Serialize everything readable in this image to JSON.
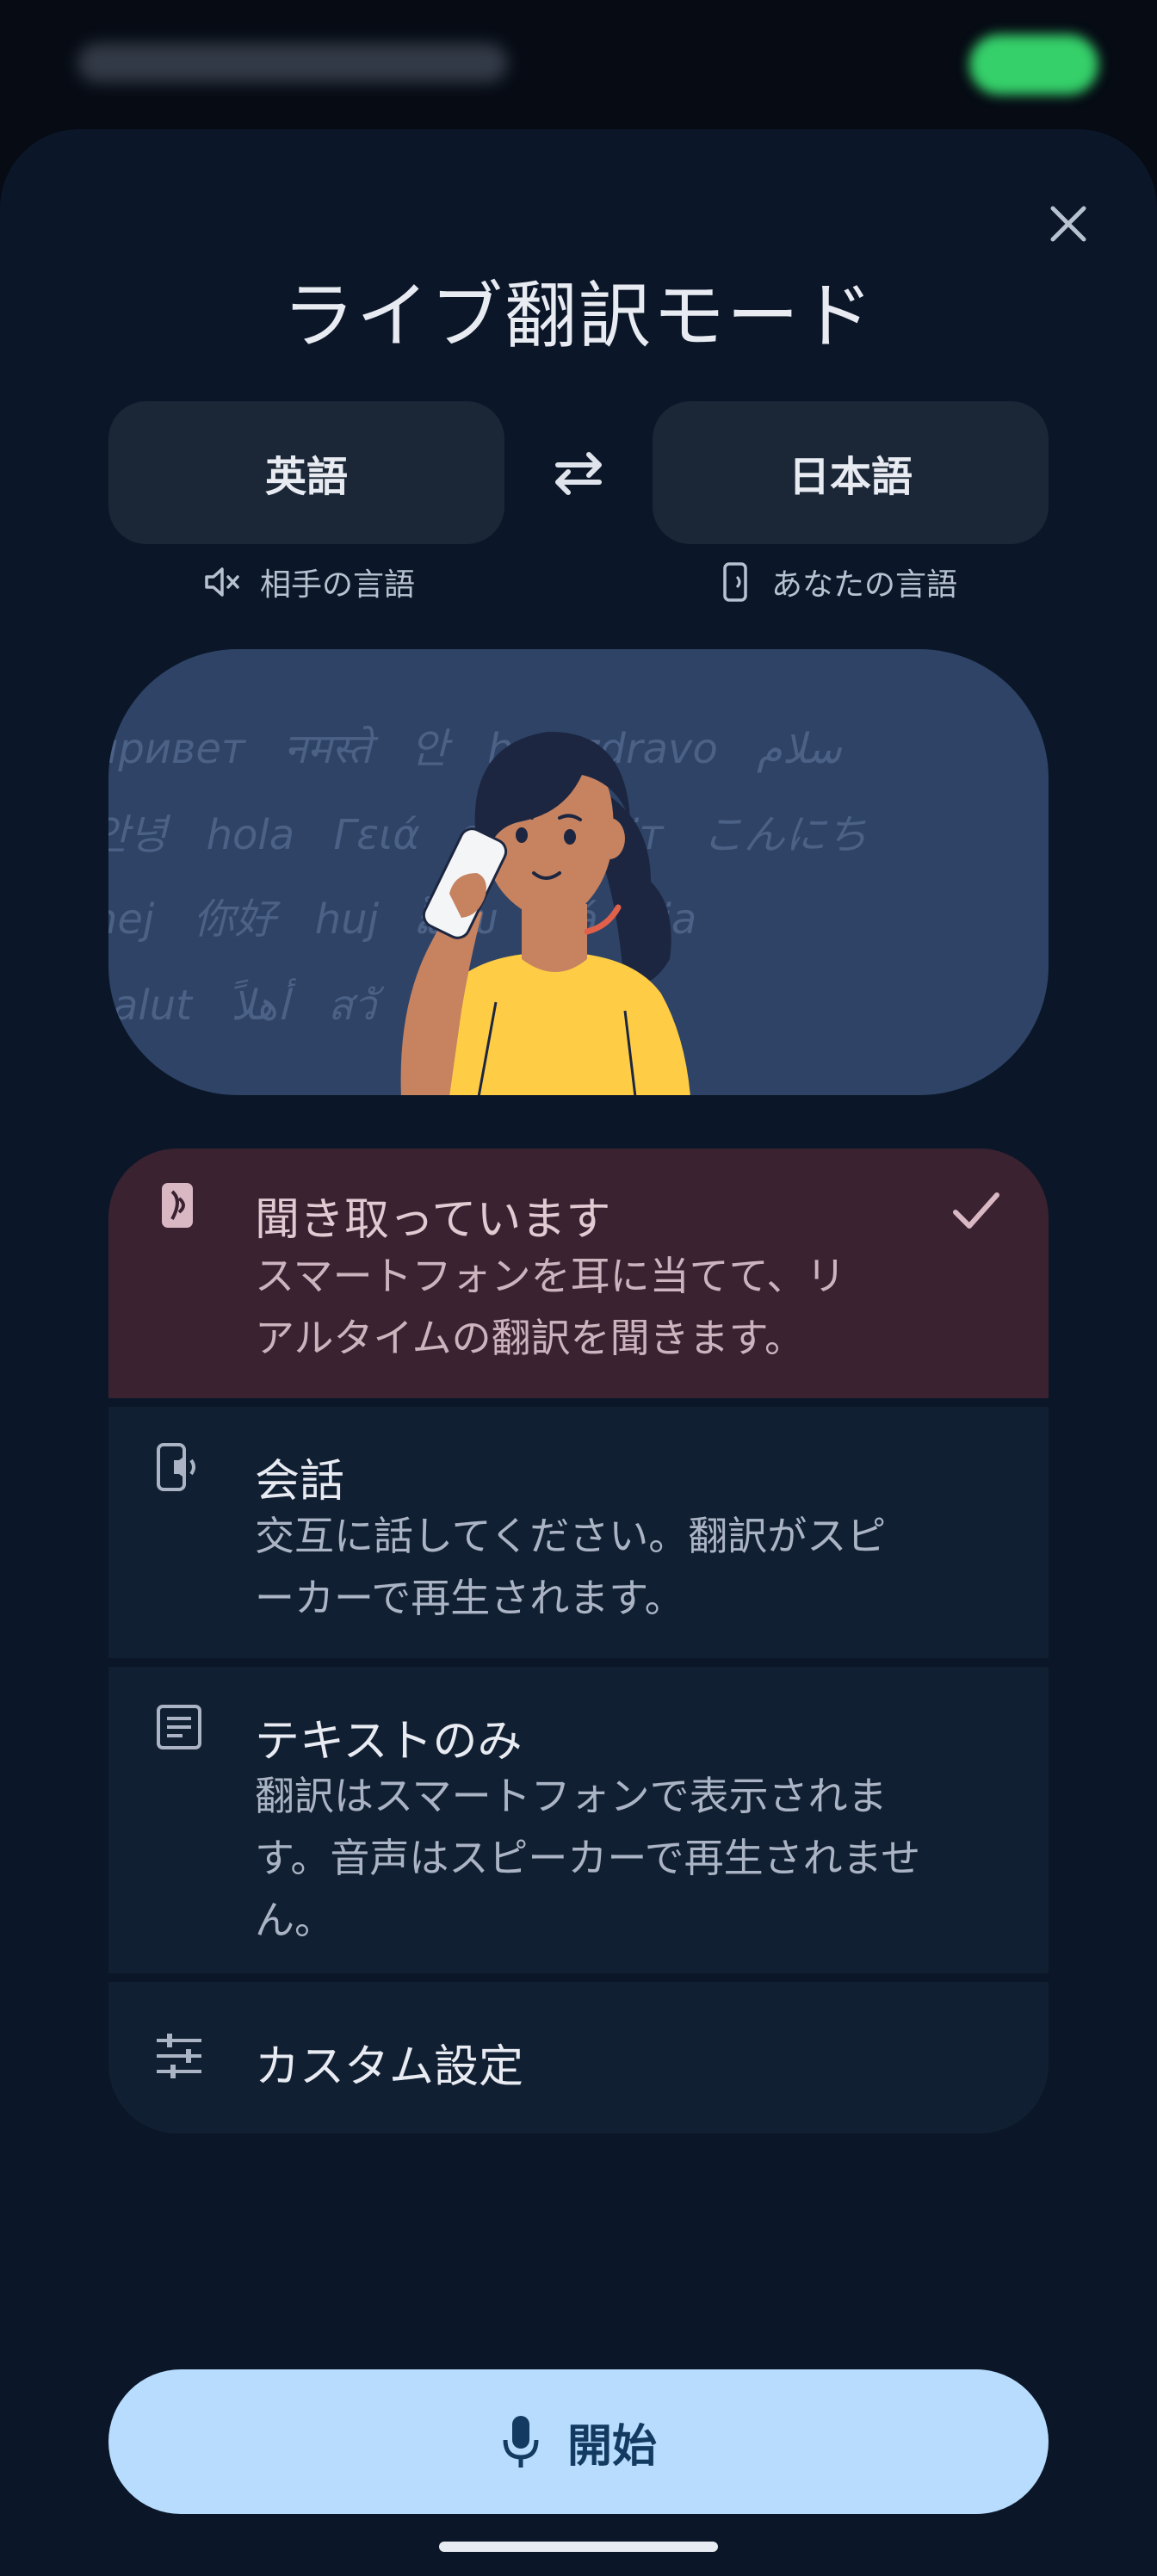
{
  "status_bar": {
    "icons": [
      "blurred-status-icons",
      "battery-icon"
    ]
  },
  "dialog": {
    "title": "ライブ翻訳モード",
    "close_icon": "close-icon"
  },
  "languages": {
    "other": {
      "label": "英語",
      "caption": "相手の言語",
      "icon": "speaker-mute-icon"
    },
    "self": {
      "label": "日本語",
      "caption": "あなたの言語",
      "icon": "phone-speaker-icon"
    },
    "swap_icon": "swap-arrows-icon"
  },
  "illustration": {
    "greetings": [
      "привет नमस्ते 안 ha zdravo سلام",
      "안녕 hola Γειά o привіт こんにち",
      "hej 你好 huj ລ້ວັນ olá cia",
      "salut أهلاً สวั שלום Maite"
    ]
  },
  "modes": [
    {
      "title": "聞き取っています",
      "desc_lines": [
        "スマートフォンを耳に当てて、リ",
        "アルタイムの翻訳を聞きます。"
      ],
      "icon": "phone-ear-icon",
      "selected": true
    },
    {
      "title": "会話",
      "desc_lines": [
        "交互に話してください。翻訳がスピ",
        "ーカーで再生されます。"
      ],
      "icon": "phone-speaker-icon",
      "selected": false
    },
    {
      "title": "テキストのみ",
      "desc_lines": [
        "翻訳はスマートフォンで表示されま",
        "す。音声はスピーカーで再生されませ",
        "ん。"
      ],
      "icon": "text-document-icon",
      "selected": false
    },
    {
      "title": "カスタム設定",
      "desc_lines": [],
      "icon": "sliders-icon",
      "selected": false
    }
  ],
  "start_button": {
    "label": "開始",
    "icon": "mic-icon"
  },
  "colors": {
    "background": "#060b14",
    "sheet": "#0b1728",
    "selected_mode": "#3a2230",
    "mode_card": "#111f33",
    "start_button": "#b7dcfe",
    "start_text": "#133a60"
  }
}
